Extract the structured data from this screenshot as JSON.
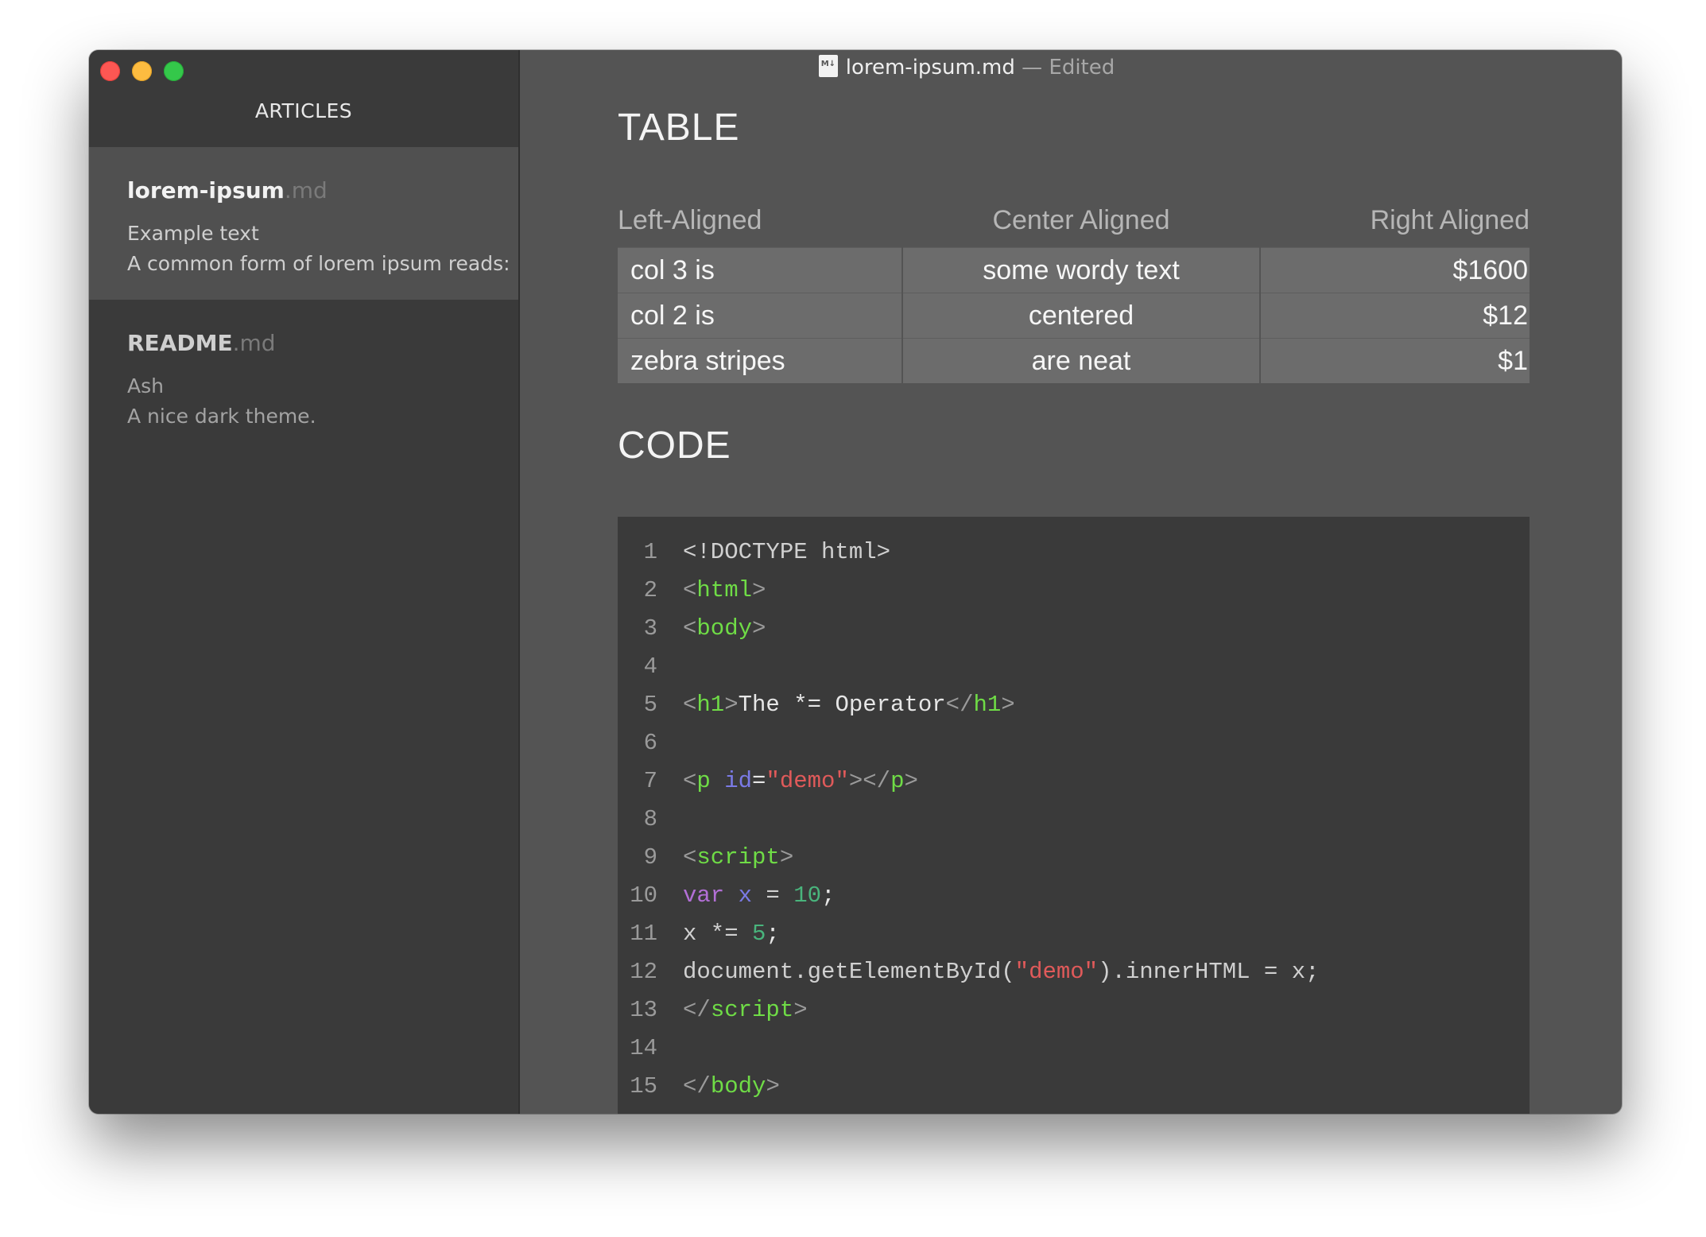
{
  "window": {
    "title": "lorem-ipsum.md",
    "status": " — Edited"
  },
  "sidebar": {
    "title": "ARTICLES",
    "articles": [
      {
        "name": "lorem-ipsum",
        "ext": ".md",
        "line1": "Example text",
        "line2": "A common form of lorem ipsum reads:"
      },
      {
        "name": "README",
        "ext": ".md",
        "line1": "Ash",
        "line2": "A nice dark theme."
      }
    ]
  },
  "content": {
    "table_heading": "TABLE",
    "code_heading": "CODE",
    "table": {
      "headers": [
        "Left-Aligned",
        "Center Aligned",
        "Right Aligned"
      ],
      "rows": [
        [
          "col 3 is",
          "some wordy text",
          "$1600"
        ],
        [
          "col 2 is",
          "centered",
          "$12"
        ],
        [
          "zebra stripes",
          "are neat",
          "$1"
        ]
      ]
    },
    "code": {
      "line_numbers": [
        "1",
        "2",
        "3",
        "4",
        "5",
        "6",
        "7",
        "8",
        "9",
        "10",
        "11",
        "12",
        "13",
        "14",
        "15"
      ],
      "lines": {
        "l1": "<!DOCTYPE html>",
        "l2_tag": "html",
        "l3_tag": "body",
        "l5_tag": "h1",
        "l5_text": "The *= Operator",
        "l7_tag": "p",
        "l7_attr": "id",
        "l7_val": "\"demo\"",
        "l9_tag": "script",
        "l10_kw": "var",
        "l10_var": "x",
        "l10_op": " = ",
        "l10_num": "10",
        "l10_end": ";",
        "l11_a": "x *= ",
        "l11_num": "5",
        "l11_end": ";",
        "l12_a": "document.getElementById(",
        "l12_str": "\"demo\"",
        "l12_b": ").innerHTML = x;",
        "l13_tag": "script",
        "l15_tag": "body"
      }
    }
  },
  "colors": {
    "window_bg": "#545454",
    "sidebar_bg": "#3a3a3a",
    "code_bg": "#3a3a3a",
    "tag": "#6fdc46",
    "string": "#e05a5a",
    "keyword": "#b26fd6",
    "number": "#49b47c",
    "attribute": "#7a7ae6"
  }
}
